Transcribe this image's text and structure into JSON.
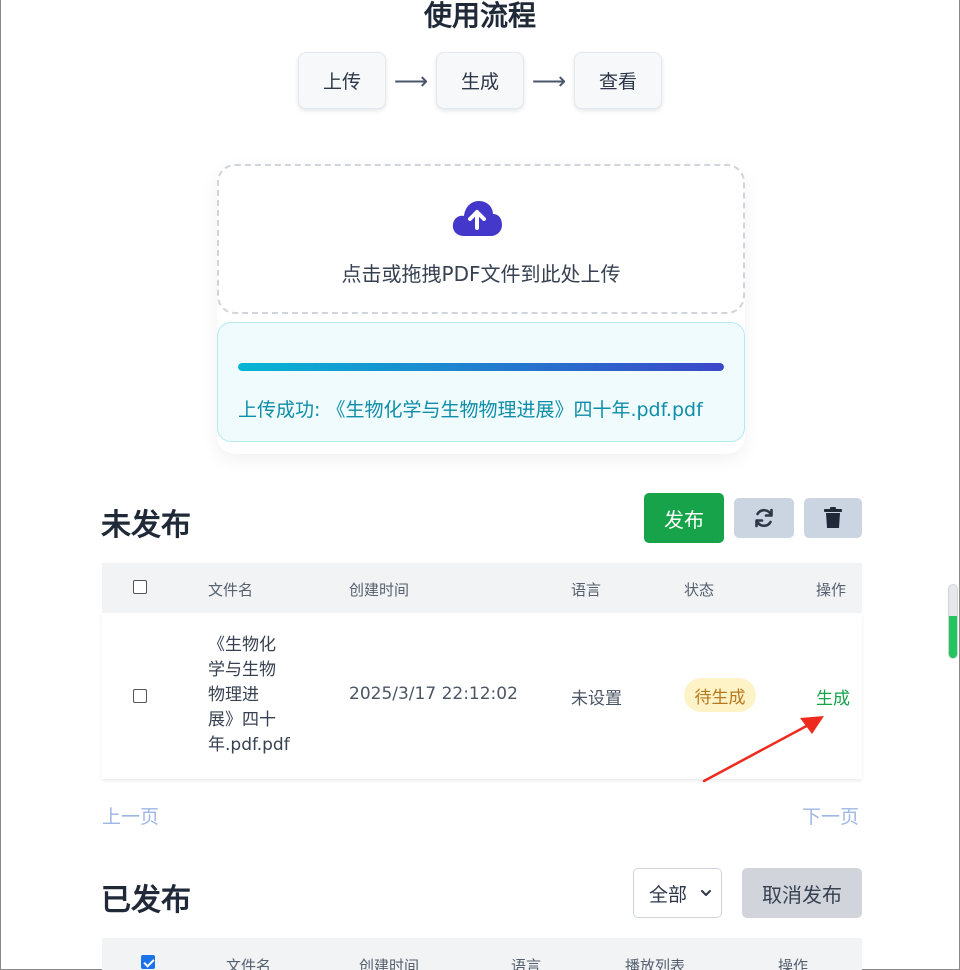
{
  "header": {
    "title": "使用流程"
  },
  "steps": [
    {
      "label": "上传"
    },
    {
      "label": "生成"
    },
    {
      "label": "查看"
    }
  ],
  "upload": {
    "dropzone_text": "点击或拖拽PDF文件到此处上传",
    "progress_percent": 100,
    "status_text": "上传成功: 《生物化学与生物物理进展》四十年.pdf.pdf"
  },
  "unpublished": {
    "title": "未发布",
    "publish_label": "发布",
    "columns": [
      "文件名",
      "创建时间",
      "语言",
      "状态",
      "操作"
    ],
    "rows": [
      {
        "filename_lines": [
          "《生物化",
          "学与生物",
          "物理进",
          "展》四十",
          "年.pdf.pdf"
        ],
        "created": "2025/3/17 22:12:02",
        "language": "未设置",
        "status": "待生成",
        "action": "生成"
      }
    ],
    "prev_label": "上一页",
    "next_label": "下一页"
  },
  "published": {
    "title": "已发布",
    "filter_value": "全部",
    "unpublish_label": "取消发布",
    "columns": [
      "文件名",
      "创建时间",
      "语言",
      "播放列表",
      "操作"
    ]
  },
  "colors": {
    "publish_green": "#16a34a",
    "progress_start": "#06b6d4",
    "progress_end": "#3b47c9",
    "status_badge_bg": "#fef3c7",
    "status_badge_text": "#b7791f",
    "annotation_arrow": "#ee2a1f"
  },
  "icons": {
    "upload": "cloud-upload-icon",
    "refresh": "refresh-icon",
    "delete": "trash-icon",
    "select_chevron": "chevron-down-icon"
  }
}
